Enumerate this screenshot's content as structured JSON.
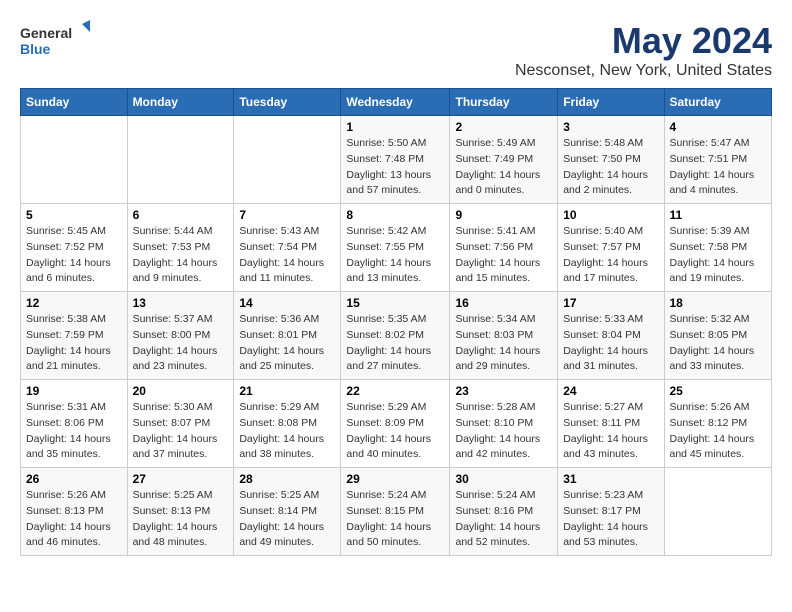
{
  "logo": {
    "text_general": "General",
    "text_blue": "Blue"
  },
  "title": "May 2024",
  "subtitle": "Nesconset, New York, United States",
  "days_of_week": [
    "Sunday",
    "Monday",
    "Tuesday",
    "Wednesday",
    "Thursday",
    "Friday",
    "Saturday"
  ],
  "weeks": [
    [
      {
        "day": "",
        "info": ""
      },
      {
        "day": "",
        "info": ""
      },
      {
        "day": "",
        "info": ""
      },
      {
        "day": "1",
        "info": "Sunrise: 5:50 AM\nSunset: 7:48 PM\nDaylight: 13 hours\nand 57 minutes."
      },
      {
        "day": "2",
        "info": "Sunrise: 5:49 AM\nSunset: 7:49 PM\nDaylight: 14 hours\nand 0 minutes."
      },
      {
        "day": "3",
        "info": "Sunrise: 5:48 AM\nSunset: 7:50 PM\nDaylight: 14 hours\nand 2 minutes."
      },
      {
        "day": "4",
        "info": "Sunrise: 5:47 AM\nSunset: 7:51 PM\nDaylight: 14 hours\nand 4 minutes."
      }
    ],
    [
      {
        "day": "5",
        "info": "Sunrise: 5:45 AM\nSunset: 7:52 PM\nDaylight: 14 hours\nand 6 minutes."
      },
      {
        "day": "6",
        "info": "Sunrise: 5:44 AM\nSunset: 7:53 PM\nDaylight: 14 hours\nand 9 minutes."
      },
      {
        "day": "7",
        "info": "Sunrise: 5:43 AM\nSunset: 7:54 PM\nDaylight: 14 hours\nand 11 minutes."
      },
      {
        "day": "8",
        "info": "Sunrise: 5:42 AM\nSunset: 7:55 PM\nDaylight: 14 hours\nand 13 minutes."
      },
      {
        "day": "9",
        "info": "Sunrise: 5:41 AM\nSunset: 7:56 PM\nDaylight: 14 hours\nand 15 minutes."
      },
      {
        "day": "10",
        "info": "Sunrise: 5:40 AM\nSunset: 7:57 PM\nDaylight: 14 hours\nand 17 minutes."
      },
      {
        "day": "11",
        "info": "Sunrise: 5:39 AM\nSunset: 7:58 PM\nDaylight: 14 hours\nand 19 minutes."
      }
    ],
    [
      {
        "day": "12",
        "info": "Sunrise: 5:38 AM\nSunset: 7:59 PM\nDaylight: 14 hours\nand 21 minutes."
      },
      {
        "day": "13",
        "info": "Sunrise: 5:37 AM\nSunset: 8:00 PM\nDaylight: 14 hours\nand 23 minutes."
      },
      {
        "day": "14",
        "info": "Sunrise: 5:36 AM\nSunset: 8:01 PM\nDaylight: 14 hours\nand 25 minutes."
      },
      {
        "day": "15",
        "info": "Sunrise: 5:35 AM\nSunset: 8:02 PM\nDaylight: 14 hours\nand 27 minutes."
      },
      {
        "day": "16",
        "info": "Sunrise: 5:34 AM\nSunset: 8:03 PM\nDaylight: 14 hours\nand 29 minutes."
      },
      {
        "day": "17",
        "info": "Sunrise: 5:33 AM\nSunset: 8:04 PM\nDaylight: 14 hours\nand 31 minutes."
      },
      {
        "day": "18",
        "info": "Sunrise: 5:32 AM\nSunset: 8:05 PM\nDaylight: 14 hours\nand 33 minutes."
      }
    ],
    [
      {
        "day": "19",
        "info": "Sunrise: 5:31 AM\nSunset: 8:06 PM\nDaylight: 14 hours\nand 35 minutes."
      },
      {
        "day": "20",
        "info": "Sunrise: 5:30 AM\nSunset: 8:07 PM\nDaylight: 14 hours\nand 37 minutes."
      },
      {
        "day": "21",
        "info": "Sunrise: 5:29 AM\nSunset: 8:08 PM\nDaylight: 14 hours\nand 38 minutes."
      },
      {
        "day": "22",
        "info": "Sunrise: 5:29 AM\nSunset: 8:09 PM\nDaylight: 14 hours\nand 40 minutes."
      },
      {
        "day": "23",
        "info": "Sunrise: 5:28 AM\nSunset: 8:10 PM\nDaylight: 14 hours\nand 42 minutes."
      },
      {
        "day": "24",
        "info": "Sunrise: 5:27 AM\nSunset: 8:11 PM\nDaylight: 14 hours\nand 43 minutes."
      },
      {
        "day": "25",
        "info": "Sunrise: 5:26 AM\nSunset: 8:12 PM\nDaylight: 14 hours\nand 45 minutes."
      }
    ],
    [
      {
        "day": "26",
        "info": "Sunrise: 5:26 AM\nSunset: 8:13 PM\nDaylight: 14 hours\nand 46 minutes."
      },
      {
        "day": "27",
        "info": "Sunrise: 5:25 AM\nSunset: 8:13 PM\nDaylight: 14 hours\nand 48 minutes."
      },
      {
        "day": "28",
        "info": "Sunrise: 5:25 AM\nSunset: 8:14 PM\nDaylight: 14 hours\nand 49 minutes."
      },
      {
        "day": "29",
        "info": "Sunrise: 5:24 AM\nSunset: 8:15 PM\nDaylight: 14 hours\nand 50 minutes."
      },
      {
        "day": "30",
        "info": "Sunrise: 5:24 AM\nSunset: 8:16 PM\nDaylight: 14 hours\nand 52 minutes."
      },
      {
        "day": "31",
        "info": "Sunrise: 5:23 AM\nSunset: 8:17 PM\nDaylight: 14 hours\nand 53 minutes."
      },
      {
        "day": "",
        "info": ""
      }
    ]
  ]
}
